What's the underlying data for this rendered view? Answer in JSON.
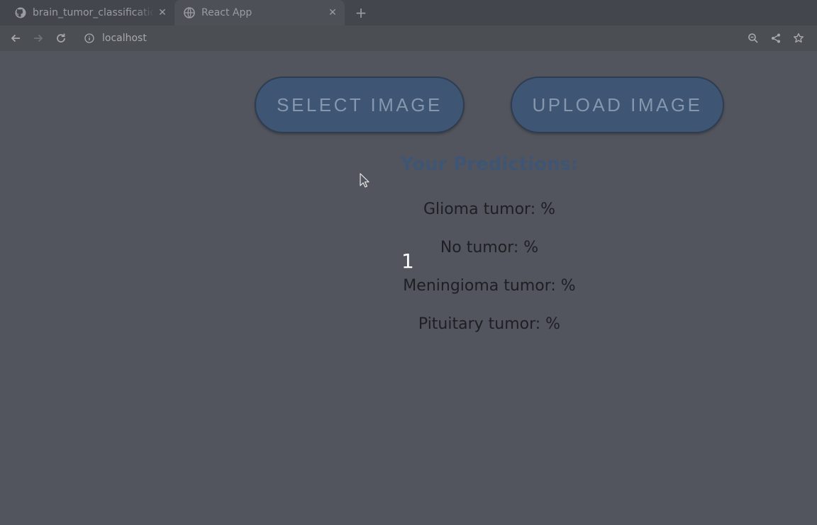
{
  "browser": {
    "tabs": [
      {
        "title": "brain_tumor_classification",
        "icon": "github-icon",
        "active": false
      },
      {
        "title": "React App",
        "icon": "globe-icon",
        "active": true
      }
    ],
    "address": "localhost"
  },
  "main": {
    "select_button": "SELECT IMAGE",
    "upload_button": "UPLOAD IMAGE",
    "predictions_title": "Your Predictions:",
    "predictions": [
      "Glioma tumor: %",
      "No tumor: %",
      "Meningioma tumor: %",
      "Pituitary tumor: %"
    ],
    "marker": "1"
  },
  "colors": {
    "page_bg": "#52555d",
    "button_bg": "#3f5574",
    "button_text": "#8597ad",
    "title": "#3f5574"
  }
}
